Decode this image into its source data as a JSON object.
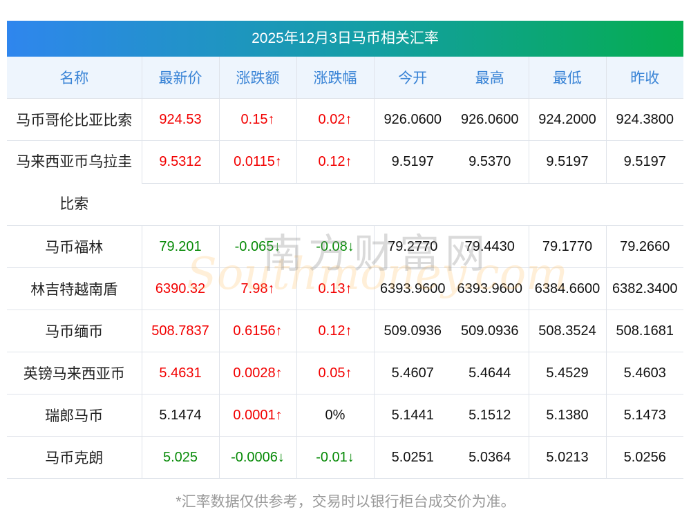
{
  "title": "2025年12月3日马币相关汇率",
  "headers": [
    "名称",
    "最新价",
    "涨跌额",
    "涨跌幅",
    "今开",
    "最高",
    "最低",
    "昨收"
  ],
  "rows": [
    {
      "name": "马币哥伦比亚比索",
      "latest": "924.53",
      "change": "0.15↑",
      "pct": "0.02↑",
      "open": "926.0600",
      "high": "926.0600",
      "low": "924.2000",
      "prev": "924.3800",
      "trend": "up"
    },
    {
      "name": "马来西亚币乌拉圭比索",
      "latest": "9.5312",
      "change": "0.0115↑",
      "pct": "0.12↑",
      "open": "9.5197",
      "high": "9.5370",
      "low": "9.5197",
      "prev": "9.5197",
      "trend": "up"
    },
    {
      "name": "马币福林",
      "latest": "79.201",
      "change": "-0.065↓",
      "pct": "-0.08↓",
      "open": "79.2770",
      "high": "79.4430",
      "low": "79.1770",
      "prev": "79.2660",
      "trend": "down"
    },
    {
      "name": "林吉特越南盾",
      "latest": "6390.32",
      "change": "7.98↑",
      "pct": "0.13↑",
      "open": "6393.9600",
      "high": "6393.9600",
      "low": "6384.6600",
      "prev": "6382.3400",
      "trend": "up"
    },
    {
      "name": "马币缅币",
      "latest": "508.7837",
      "change": "0.6156↑",
      "pct": "0.12↑",
      "open": "509.0936",
      "high": "509.0936",
      "low": "508.3524",
      "prev": "508.1681",
      "trend": "up"
    },
    {
      "name": "英镑马来西亚币",
      "latest": "5.4631",
      "change": "0.0028↑",
      "pct": "0.05↑",
      "open": "5.4607",
      "high": "5.4644",
      "low": "5.4529",
      "prev": "5.4603",
      "trend": "up"
    },
    {
      "name": "瑞郎马币",
      "latest": "5.1474",
      "change": "0.0001↑",
      "pct": "0%",
      "open": "5.1441",
      "high": "5.1512",
      "low": "5.1380",
      "prev": "5.1473",
      "trend": "up-flatpct"
    },
    {
      "name": "马币克朗",
      "latest": "5.025",
      "change": "-0.0006↓",
      "pct": "-0.01↓",
      "open": "5.0251",
      "high": "5.0364",
      "low": "5.0213",
      "prev": "5.0256",
      "trend": "down"
    }
  ],
  "watermark": {
    "cn": "南方财富网",
    "en": "Southmoney.com"
  },
  "footnote": "*汇率数据仅供参考，交易时以银行柜台成交价为准。",
  "colors": {
    "up": "#f20000",
    "down": "#078a07",
    "header_text": "#3a84d6"
  }
}
